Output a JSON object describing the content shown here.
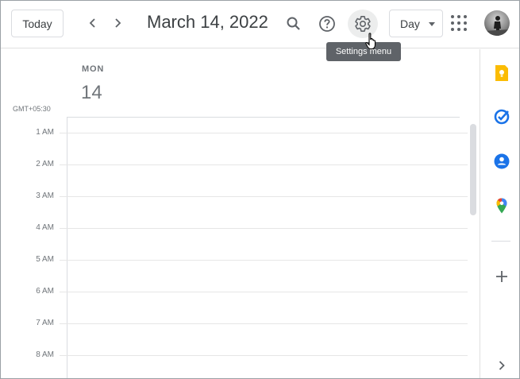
{
  "header": {
    "today_label": "Today",
    "date_title": "March 14, 2022",
    "view_label": "Day",
    "tooltip": "Settings menu"
  },
  "icons": {
    "prev": "chevron-left-icon",
    "next": "chevron-right-icon",
    "search": "search-icon",
    "help": "help-icon",
    "settings": "gear-icon",
    "apps": "apps-grid-icon"
  },
  "day": {
    "weekday": "MON",
    "day_number": "14"
  },
  "timezone": "GMT+05:30",
  "hours": [
    "1 AM",
    "2 AM",
    "3 AM",
    "4 AM",
    "5 AM",
    "6 AM",
    "7 AM",
    "8 AM"
  ],
  "side_panel": {
    "items": [
      "keep-icon",
      "tasks-icon",
      "contacts-icon",
      "maps-icon",
      "add-icon",
      "expand-icon"
    ]
  },
  "colors": {
    "keep": "#fbbc04",
    "tasks": "#1a73e8",
    "contacts": "#1a73e8",
    "tooltip_bg": "#5f6368"
  }
}
